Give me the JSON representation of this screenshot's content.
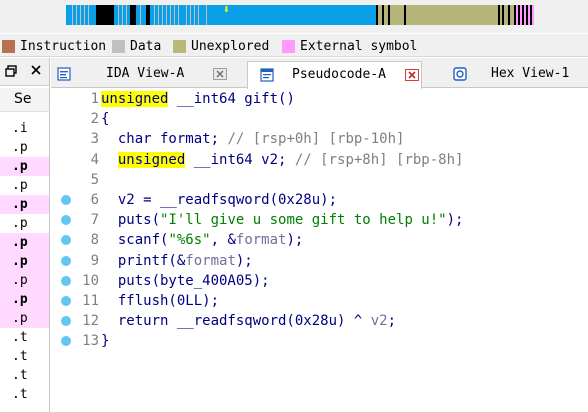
{
  "navband": {
    "colors": {
      "background": "#f0f0f0",
      "code": "#0aa0e8",
      "data": "#c0c0c0",
      "unexplored": "#b5b57a",
      "external": "#ff99ff",
      "marker": "#000000",
      "cursor": "#ffff00"
    },
    "cursor_glyph": "⬇"
  },
  "legend": {
    "items": [
      {
        "label": "Instruction",
        "color": "#b87050"
      },
      {
        "label": "Data",
        "color": "#c0c0c0"
      },
      {
        "label": "Unexplored",
        "color": "#b8b878"
      },
      {
        "label": "External symbol",
        "color": "#ff99ff"
      }
    ]
  },
  "sidepanel": {
    "restore_icon": "window-restore-icon",
    "close_icon": "close-icon",
    "column_header": "Se",
    "rows": [
      {
        "text": ".i",
        "bold": false,
        "pink": false
      },
      {
        "text": ".p",
        "bold": false,
        "pink": false
      },
      {
        "text": ".p",
        "bold": true,
        "pink": true
      },
      {
        "text": ".p",
        "bold": false,
        "pink": false
      },
      {
        "text": ".p",
        "bold": true,
        "pink": true
      },
      {
        "text": ".p",
        "bold": false,
        "pink": false
      },
      {
        "text": ".p",
        "bold": true,
        "pink": true
      },
      {
        "text": ".p",
        "bold": true,
        "pink": true
      },
      {
        "text": ".p",
        "bold": false,
        "pink": true
      },
      {
        "text": ".p",
        "bold": true,
        "pink": true
      },
      {
        "text": ".p",
        "bold": false,
        "pink": true
      },
      {
        "text": ".t",
        "bold": false,
        "pink": false
      },
      {
        "text": ".t",
        "bold": false,
        "pink": false
      },
      {
        "text": ".t",
        "bold": false,
        "pink": false
      },
      {
        "text": ".t",
        "bold": false,
        "pink": false
      }
    ]
  },
  "tabs": [
    {
      "label": "IDA View-A",
      "icon": "ida-view-icon",
      "active": false
    },
    {
      "label": "Pseudocode-A",
      "icon": "pseudocode-icon",
      "active": true
    },
    {
      "label": "Hex View-1",
      "icon": "hex-view-icon",
      "active": false
    }
  ],
  "code": {
    "colors": {
      "text": "#000080",
      "keyword_highlight": "#ffff00",
      "comment": "#808080",
      "string": "#008000",
      "breakpoint": "#62c7f0"
    },
    "lines": [
      {
        "num": "1",
        "bp": false,
        "parts": [
          {
            "t": "unsigned",
            "c": "kw-hl"
          },
          {
            "t": " __int64 gift()",
            "c": ""
          }
        ]
      },
      {
        "num": "2",
        "bp": false,
        "parts": [
          {
            "t": "{",
            "c": ""
          }
        ]
      },
      {
        "num": "3",
        "bp": false,
        "parts": [
          {
            "t": "  char format; ",
            "c": ""
          },
          {
            "t": "// [rsp+0h] [rbp-10h]",
            "c": "cmt"
          }
        ]
      },
      {
        "num": "4",
        "bp": false,
        "parts": [
          {
            "t": "  ",
            "c": ""
          },
          {
            "t": "unsigned",
            "c": "kw-hl"
          },
          {
            "t": " __int64 v2; ",
            "c": ""
          },
          {
            "t": "// [rsp+8h] [rbp-8h]",
            "c": "cmt"
          }
        ]
      },
      {
        "num": "5",
        "bp": false,
        "parts": [
          {
            "t": "",
            "c": ""
          }
        ]
      },
      {
        "num": "6",
        "bp": true,
        "parts": [
          {
            "t": "  v2 = __readfsqword(0x28u);",
            "c": ""
          }
        ]
      },
      {
        "num": "7",
        "bp": true,
        "parts": [
          {
            "t": "  puts(",
            "c": ""
          },
          {
            "t": "\"I'll give u some gift to help u!\"",
            "c": "str"
          },
          {
            "t": ");",
            "c": ""
          }
        ]
      },
      {
        "num": "8",
        "bp": true,
        "parts": [
          {
            "t": "  scanf(",
            "c": ""
          },
          {
            "t": "\"%6s\"",
            "c": "str"
          },
          {
            "t": ", &",
            "c": ""
          },
          {
            "t": "format",
            "c": "var"
          },
          {
            "t": ");",
            "c": ""
          }
        ]
      },
      {
        "num": "9",
        "bp": true,
        "parts": [
          {
            "t": "  printf(&",
            "c": ""
          },
          {
            "t": "format",
            "c": "var"
          },
          {
            "t": ");",
            "c": ""
          }
        ]
      },
      {
        "num": "10",
        "bp": true,
        "parts": [
          {
            "t": "  puts(byte_400A05);",
            "c": ""
          }
        ]
      },
      {
        "num": "11",
        "bp": true,
        "parts": [
          {
            "t": "  fflush(0LL);",
            "c": ""
          }
        ]
      },
      {
        "num": "12",
        "bp": true,
        "parts": [
          {
            "t": "  return __readfsqword(0x28u) ^ ",
            "c": ""
          },
          {
            "t": "v2",
            "c": "var"
          },
          {
            "t": ";",
            "c": ""
          }
        ]
      },
      {
        "num": "13",
        "bp": true,
        "parts": [
          {
            "t": "}",
            "c": ""
          }
        ]
      }
    ]
  }
}
